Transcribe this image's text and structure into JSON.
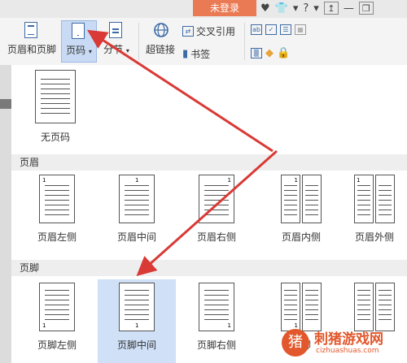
{
  "titlebar": {
    "login_label": "未登录",
    "icons": [
      "skin-icon",
      "shirt-icon",
      "help-icon",
      "minimize-to-tray-icon",
      "minimize-icon",
      "restore-icon"
    ],
    "help_label": "?",
    "dropdown_glyph": "▾"
  },
  "ribbon": {
    "header_footer_label": "页眉和页脚",
    "page_number_label": "页码",
    "page_number_caret": "▾",
    "section_label": "分节",
    "section_caret": "▾",
    "hyperlink_label": "超链接",
    "cross_ref_label": "交叉引用",
    "bookmark_label": "书签"
  },
  "dropdown": {
    "none": {
      "label": "无页码"
    },
    "header_section": {
      "title": "页眉",
      "options": [
        {
          "label": "页眉左侧",
          "number": "1"
        },
        {
          "label": "页眉中间",
          "number": "1"
        },
        {
          "label": "页眉右侧",
          "number": "1"
        },
        {
          "label": "页眉内侧",
          "number": "1"
        },
        {
          "label": "页眉外侧",
          "number": "1"
        }
      ]
    },
    "footer_section": {
      "title": "页脚",
      "options": [
        {
          "label": "页脚左侧",
          "number": "1",
          "selected": false
        },
        {
          "label": "页脚中间",
          "number": "1",
          "selected": true
        },
        {
          "label": "页脚右侧",
          "number": "1",
          "selected": false
        },
        {
          "label": "页脚",
          "number": "1",
          "selected": false
        },
        {
          "label": "",
          "number": "",
          "selected": false
        }
      ]
    }
  },
  "watermark": {
    "title": "刺猪游戏网",
    "url": "cizhuashuas.com"
  },
  "colors": {
    "login_bg": "#ea7a53",
    "selected_bg": "#cfe0f7",
    "arrow": "#d93a35",
    "icon_blue": "#3b6aa6"
  }
}
